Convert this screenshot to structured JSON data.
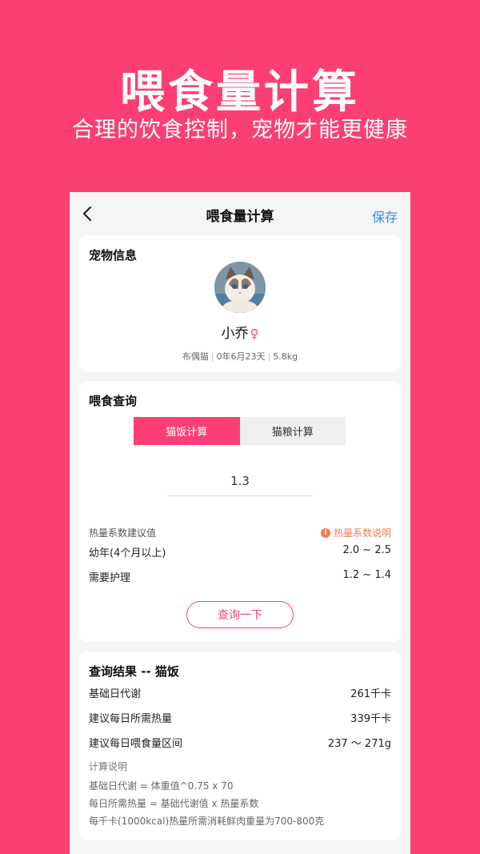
{
  "hero": {
    "title": "喂食量计算",
    "subtitle": "合理的饮食控制，宠物才能更健康"
  },
  "navbar": {
    "back_icon": "chevron-left-icon",
    "title": "喂食量计算",
    "save_label": "保存"
  },
  "pet_info": {
    "section_title": "宠物信息",
    "name": "小乔",
    "gender_symbol": "♀",
    "breed": "布偶猫",
    "age": "0年6月23天",
    "weight": "5.8kg"
  },
  "feeding": {
    "section_title": "喂食查询",
    "tabs": [
      {
        "label": "猫饭计算",
        "active": true
      },
      {
        "label": "猫粮计算",
        "active": false
      }
    ],
    "coefficient_value": "1.3",
    "coef_label": "热量系数建议值",
    "coef_help": "热量系数说明",
    "rows": [
      {
        "label": "幼年(4个月以上)",
        "value": "2.0 ~ 2.5"
      },
      {
        "label": "需要护理",
        "value": "1.2 ~ 1.4"
      }
    ],
    "query_button": "查询一下"
  },
  "result": {
    "title": "查询结果 -- 猫饭",
    "rows": [
      {
        "label": "基础日代谢",
        "value": "261千卡"
      },
      {
        "label": "建议每日所需热量",
        "value": "339千卡"
      },
      {
        "label": "建议每日喂食量区间",
        "value": "237 ～ 271g"
      }
    ],
    "notes_title": "计算说明",
    "notes": [
      "基础日代谢 = 体重值^0.75 x 70",
      "每日所需热量 = 基础代谢值 x 热量系数",
      "每千卡(1000kcal)热量所需消耗鲜肉重量为700-800克"
    ]
  },
  "colors": {
    "brand_pink": "#FC3F72",
    "link_blue": "#2E8FE8",
    "help_orange": "#F07E55"
  }
}
